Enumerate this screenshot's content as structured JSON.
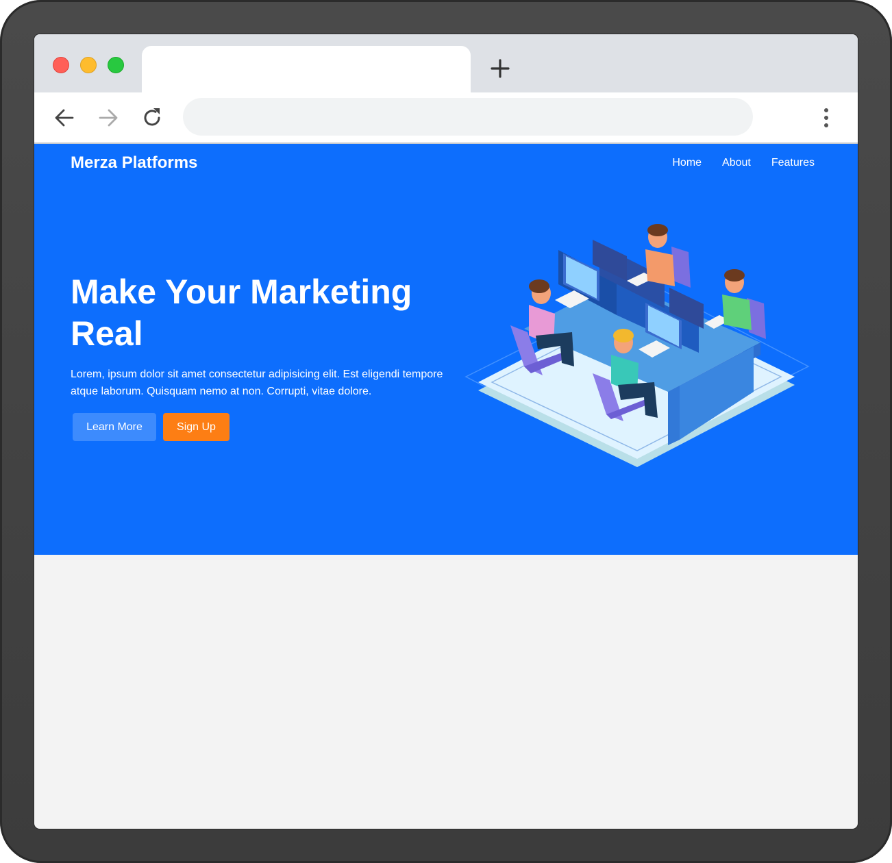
{
  "site": {
    "brand": "Merza Platforms",
    "nav": [
      {
        "label": "Home"
      },
      {
        "label": "About"
      },
      {
        "label": "Features"
      }
    ],
    "hero": {
      "title": "Make Your Marketing Real",
      "text": "Lorem, ipsum dolor sit amet consectetur adipisicing elit. Est eligendi tempore atque laborum. Quisquam nemo at non. Corrupti, vitae dolore.",
      "learn_more": "Learn More",
      "sign_up": "Sign Up"
    }
  },
  "colors": {
    "hero_bg": "#0d6efd",
    "learn_btn": "#3d8bfd",
    "signup_btn": "#fd7e14"
  },
  "icons": [
    "back-arrow-icon",
    "forward-arrow-icon",
    "reload-icon",
    "plus-icon",
    "kebab-menu-icon"
  ]
}
